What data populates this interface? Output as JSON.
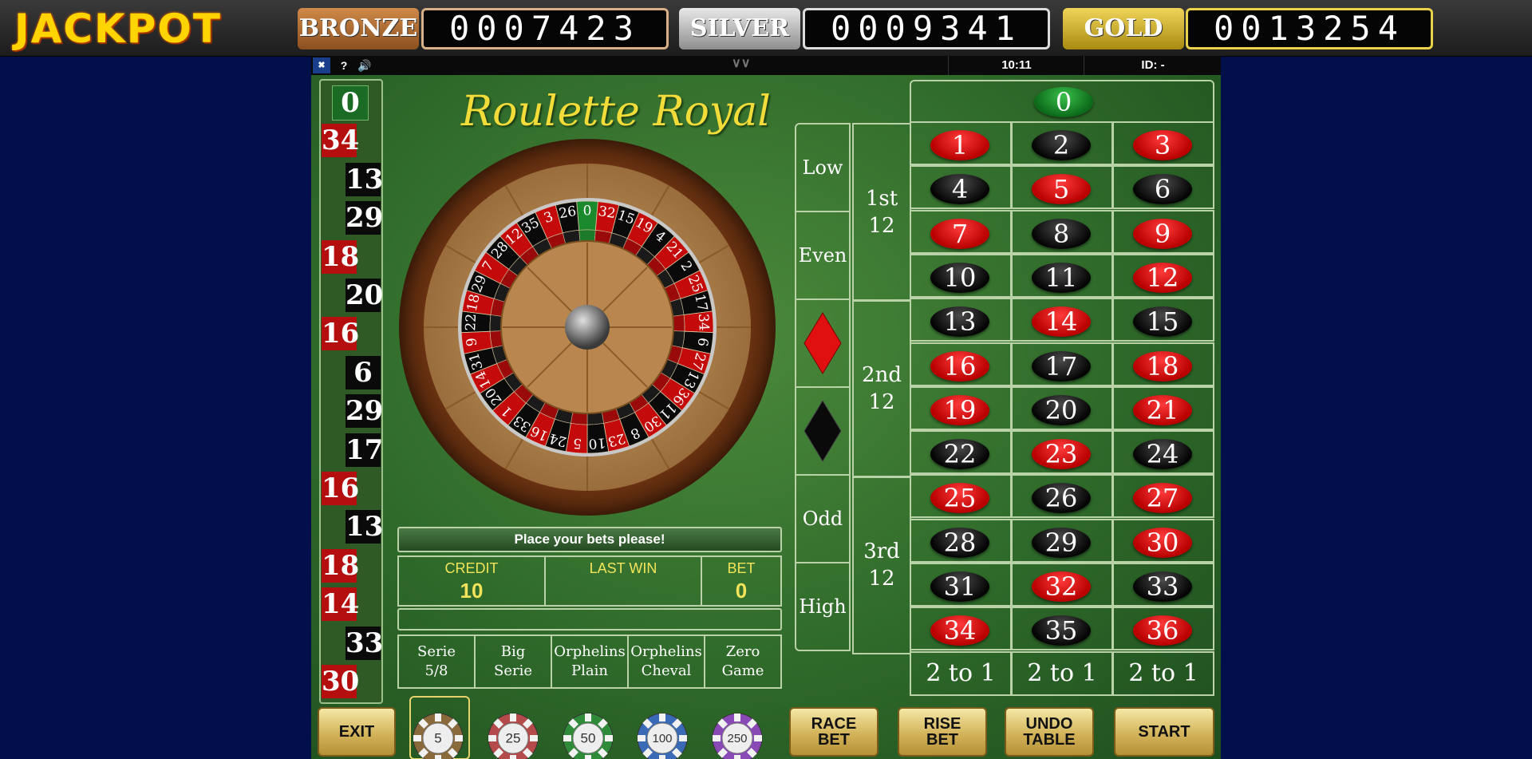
{
  "jackpot": {
    "title": "JACKPOT",
    "bronze_label": "BRONZE",
    "bronze_value": "0007423",
    "silver_label": "SILVER",
    "silver_value": "0009341",
    "gold_label": "GOLD",
    "gold_value": "0013254"
  },
  "status": {
    "help": "?",
    "time": "10:11",
    "id": "ID: -"
  },
  "game": {
    "title": "Roulette Royal",
    "message": "Place your bets please!",
    "credit_label": "CREDIT",
    "credit_value": "10",
    "last_win_label": "LAST WIN",
    "last_win_value": "",
    "bet_label": "BET",
    "bet_value": "0"
  },
  "history": [
    {
      "n": "0",
      "c": "green"
    },
    {
      "n": "34",
      "c": "red"
    },
    {
      "n": "13",
      "c": "black"
    },
    {
      "n": "29",
      "c": "black"
    },
    {
      "n": "18",
      "c": "red"
    },
    {
      "n": "20",
      "c": "black"
    },
    {
      "n": "16",
      "c": "red"
    },
    {
      "n": "6",
      "c": "black"
    },
    {
      "n": "29",
      "c": "black"
    },
    {
      "n": "17",
      "c": "black"
    },
    {
      "n": "16",
      "c": "red"
    },
    {
      "n": "13",
      "c": "black"
    },
    {
      "n": "18",
      "c": "red"
    },
    {
      "n": "14",
      "c": "red"
    },
    {
      "n": "33",
      "c": "black"
    },
    {
      "n": "30",
      "c": "red"
    }
  ],
  "special_bets": [
    {
      "label1": "Serie",
      "label2": "5/8"
    },
    {
      "label1": "Big",
      "label2": "Serie"
    },
    {
      "label1": "Orphelins",
      "label2": "Plain"
    },
    {
      "label1": "Orphelins",
      "label2": "Cheval"
    },
    {
      "label1": "Zero",
      "label2": "Game"
    }
  ],
  "outside": {
    "low": "Low",
    "even": "Even",
    "odd": "Odd",
    "high": "High"
  },
  "dozens": [
    {
      "l1": "1st",
      "l2": "12"
    },
    {
      "l1": "2nd",
      "l2": "12"
    },
    {
      "l1": "3rd",
      "l2": "12"
    }
  ],
  "columns": [
    "2 to 1",
    "2 to 1",
    "2 to 1"
  ],
  "red_numbers": [
    1,
    3,
    5,
    7,
    9,
    12,
    14,
    16,
    18,
    19,
    21,
    23,
    25,
    27,
    30,
    32,
    34,
    36
  ],
  "wheel_order": [
    0,
    32,
    15,
    19,
    4,
    21,
    2,
    25,
    17,
    34,
    6,
    27,
    13,
    36,
    11,
    30,
    8,
    23,
    10,
    5,
    24,
    16,
    33,
    1,
    20,
    14,
    31,
    9,
    22,
    18,
    29,
    7,
    28,
    12,
    35,
    3,
    26
  ],
  "chips": [
    {
      "value": "5",
      "color": "#8a6a3a"
    },
    {
      "value": "25",
      "color": "#b54a4a"
    },
    {
      "value": "50",
      "color": "#2f8a3a"
    },
    {
      "value": "100",
      "color": "#3a6ab5"
    },
    {
      "value": "250",
      "color": "#8a4ab5"
    }
  ],
  "buttons": {
    "exit": "EXIT",
    "race_1": "RACE",
    "race_2": "BET",
    "rise_1": "RISE",
    "rise_2": "BET",
    "undo_1": "UNDO",
    "undo_2": "TABLE",
    "start": "START"
  },
  "colors": {
    "red": "#c40a0a",
    "black": "#0a0a0a",
    "green": "#1b8a2c",
    "text_yellow": "#f1e45a"
  }
}
